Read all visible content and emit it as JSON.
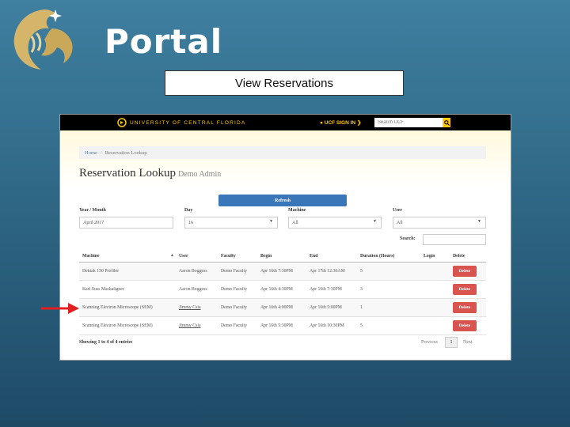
{
  "slide": {
    "title": "Portal",
    "caption": "View Reservations"
  },
  "colors": {
    "ucf_gold": "#ffc904",
    "refresh_blue": "#3a77b8",
    "delete_red": "#d9534f",
    "arrow_red": "#e02020",
    "slide_bg": "#2f6886"
  },
  "screenshot": {
    "header": {
      "university": "UNIVERSITY OF CENTRAL FLORIDA",
      "signin": "UCF SIGN IN",
      "search_placeholder": "Search UCF"
    },
    "breadcrumb": {
      "home": "Home",
      "separator": "/",
      "current": "Reservation Lookup"
    },
    "heading": {
      "title": "Reservation Lookup",
      "subtitle": "Demo Admin"
    },
    "refresh_label": "Refresh",
    "filters": {
      "year_month": {
        "label": "Year / Month",
        "value": "April 2017"
      },
      "day": {
        "label": "Day",
        "value": "16"
      },
      "machine": {
        "label": "Machine",
        "value": "All"
      },
      "user": {
        "label": "User",
        "value": "All"
      }
    },
    "search_label": "Search:",
    "table": {
      "headers": [
        "Machine",
        "User",
        "Faculty",
        "Begin",
        "End",
        "Duration (Hours)",
        "Login",
        "Delete"
      ],
      "rows": [
        {
          "machine": "Dektak 150 Profiler",
          "user": "Aaron Boggess",
          "faculty": "Demo Faculty",
          "begin": "Apr 16th 7:30PM",
          "end": "Apr 17th 12:30AM",
          "duration": "5",
          "login": "",
          "delete": "Delete"
        },
        {
          "machine": "Karl Suss Maskaligner",
          "user": "Aaron Boggess",
          "faculty": "Demo Faculty",
          "begin": "Apr 16th 4:30PM",
          "end": "Apr 16th 7:30PM",
          "duration": "3",
          "login": "",
          "delete": "Delete"
        },
        {
          "machine": "Scanning Electron Microscope (SEM)",
          "user": "Jimmy Csia",
          "faculty": "Demo Faculty",
          "begin": "Apr 16th 4:00PM",
          "end": "Apr 16th 5:00PM",
          "duration": "1",
          "login": "",
          "delete": "Delete"
        },
        {
          "machine": "Scanning Electron Microscope (SEM)",
          "user": "Jimmy Csia",
          "faculty": "Demo Faculty",
          "begin": "Apr 16th 5:30PM",
          "end": "Apr 16th 10:30PM",
          "duration": "5",
          "login": "",
          "delete": "Delete"
        }
      ]
    },
    "showing": "Showing 1 to 4 of 4 entries",
    "pagination": {
      "previous": "Previous",
      "page": "1",
      "next": "Next"
    }
  }
}
